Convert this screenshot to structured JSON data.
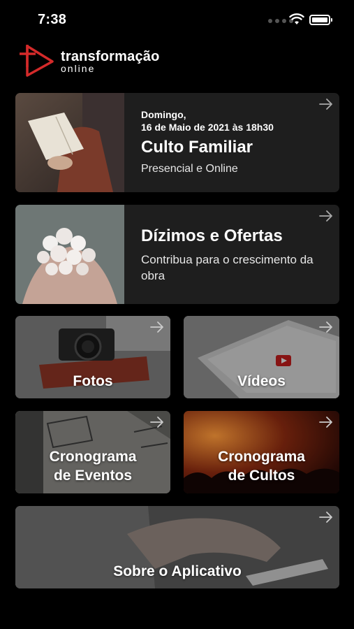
{
  "status_bar": {
    "time": "7:38"
  },
  "logo": {
    "word": "transformação",
    "sub": "online"
  },
  "cards": {
    "culto": {
      "date_line1": "Domingo,",
      "date_line2": "16 de Maio de 2021 às 18h30",
      "title": "Culto Familiar",
      "subtitle": "Presencial e Online"
    },
    "dizimos": {
      "title": "Dízimos e Ofertas",
      "subtitle": "Contribua para o crescimento da obra"
    },
    "fotos": {
      "label": "Fotos"
    },
    "videos": {
      "label": "Vídeos"
    },
    "eventos": {
      "line1": "Cronograma",
      "line2": "de Eventos"
    },
    "cultos": {
      "line1": "Cronograma",
      "line2": "de Cultos"
    },
    "sobre": {
      "label": "Sobre o Aplicativo"
    }
  },
  "colors": {
    "accent": "#d42a2a",
    "card_bg": "#1e1e1e",
    "background": "#000000"
  }
}
